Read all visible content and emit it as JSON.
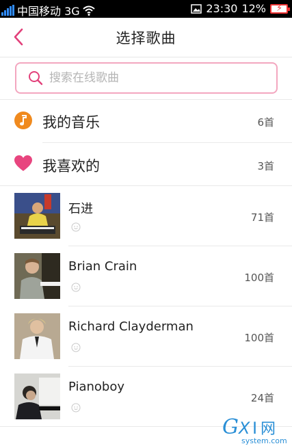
{
  "status_bar": {
    "carrier": "中国移动 3G",
    "time": "23:30",
    "battery": "12%"
  },
  "header": {
    "title": "选择歌曲"
  },
  "search": {
    "placeholder": "搜索在线歌曲"
  },
  "categories": [
    {
      "label": "我的音乐",
      "count": "6首",
      "icon": "music-note-icon"
    },
    {
      "label": "我喜欢的",
      "count": "3首",
      "icon": "heart-icon"
    }
  ],
  "artists": [
    {
      "name": "石进",
      "count": "71首"
    },
    {
      "name": "Brian Crain",
      "count": "100首"
    },
    {
      "name": "Richard Clayderman",
      "count": "100首"
    },
    {
      "name": "Pianoboy",
      "count": "24首"
    }
  ],
  "watermark": {
    "logo": "GXI网",
    "url": "system.com"
  },
  "colors": {
    "accent_pink": "#e2407a",
    "music_orange": "#f08a1e",
    "heart_pink": "#e8457f",
    "search_border": "#f3a6bf"
  }
}
